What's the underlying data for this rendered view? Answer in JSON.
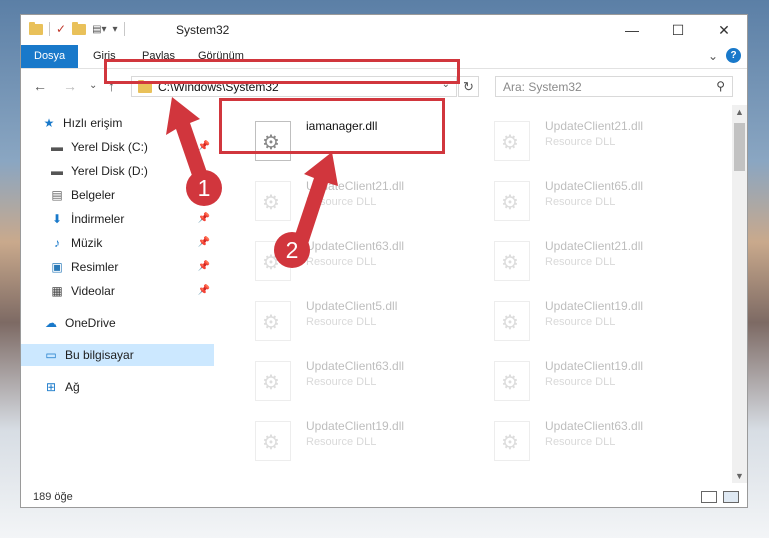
{
  "window": {
    "title": "System32",
    "controls": {
      "minimize": "—",
      "maximize": "☐",
      "close": "✕"
    }
  },
  "ribbon": {
    "tabs": [
      "Dosya",
      "Giriş",
      "Paylaş",
      "Görünüm"
    ],
    "expand_icon": "⌄",
    "help_label": "?"
  },
  "nav": {
    "back": "←",
    "forward": "→",
    "recent": "⌄",
    "up": "↑",
    "address": "C:\\Windows\\System32",
    "refresh": "↻",
    "search_placeholder": "Ara: System32"
  },
  "sidebar": {
    "items": [
      {
        "label": "Hızlı erişim",
        "icon": "star-icon"
      },
      {
        "label": "Yerel Disk (C:)",
        "icon": "drive-icon"
      },
      {
        "label": "Yerel Disk (D:)",
        "icon": "drive-icon"
      },
      {
        "label": "Belgeler",
        "icon": "documents-icon"
      },
      {
        "label": "İndirmeler",
        "icon": "downloads-icon"
      },
      {
        "label": "Müzik",
        "icon": "music-icon"
      },
      {
        "label": "Resimler",
        "icon": "pictures-icon"
      },
      {
        "label": "Videolar",
        "icon": "videos-icon"
      },
      {
        "label": "OneDrive",
        "icon": "cloud-icon"
      },
      {
        "label": "Bu bilgisayar",
        "icon": "computer-icon"
      },
      {
        "label": "Ağ",
        "icon": "network-icon"
      }
    ]
  },
  "files": [
    {
      "name": "iamanager.dll",
      "type": ""
    },
    {
      "name": "UpdateClient21.dll",
      "type": "Resource DLL"
    },
    {
      "name": "UpdateClient21.dll",
      "type": "Resource DLL"
    },
    {
      "name": "UpdateClient65.dll",
      "type": "Resource DLL"
    },
    {
      "name": "UpdateClient63.dll",
      "type": "Resource DLL"
    },
    {
      "name": "UpdateClient21.dll",
      "type": "Resource DLL"
    },
    {
      "name": "UpdateClient5.dll",
      "type": "Resource DLL"
    },
    {
      "name": "UpdateClient19.dll",
      "type": "Resource DLL"
    },
    {
      "name": "UpdateClient63.dll",
      "type": "Resource DLL"
    },
    {
      "name": "UpdateClient19.dll",
      "type": "Resource DLL"
    },
    {
      "name": "UpdateClient19.dll",
      "type": "Resource DLL"
    },
    {
      "name": "UpdateClient63.dll",
      "type": "Resource DLL"
    }
  ],
  "status": {
    "count": "189 öğe"
  },
  "annotations": {
    "badge_1": "1",
    "badge_2": "2"
  },
  "colors": {
    "accent": "#1979ca",
    "highlight": "#d1363d",
    "selected": "#cce8ff"
  }
}
